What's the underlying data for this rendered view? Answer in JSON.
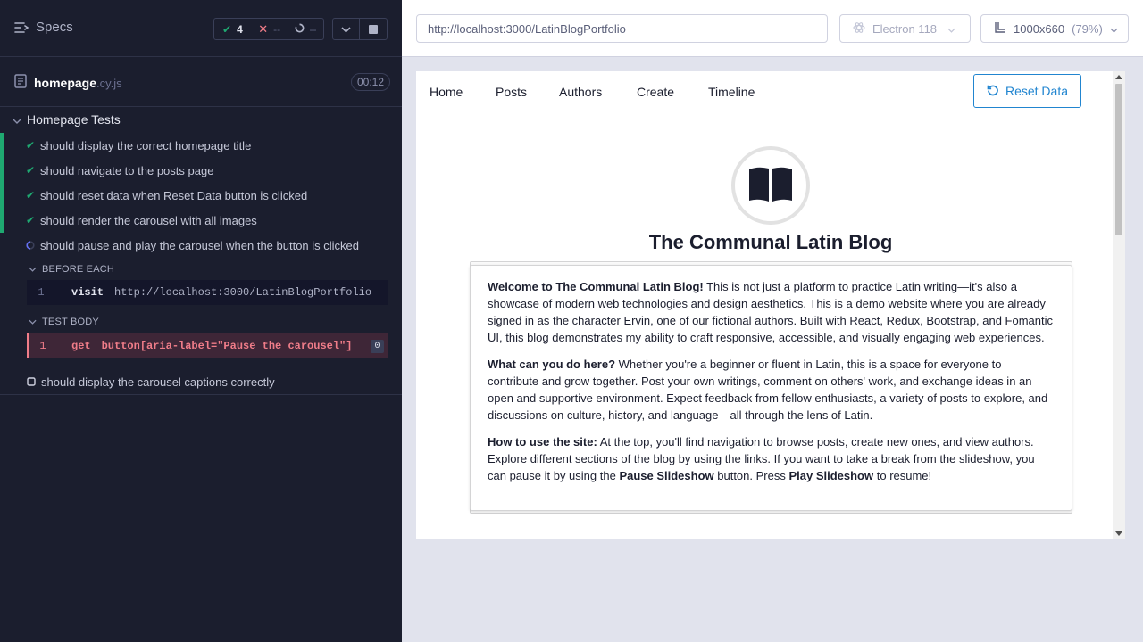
{
  "runner": {
    "specs_label": "Specs",
    "stats": {
      "passed": "4",
      "failed": "--",
      "pending": "--"
    },
    "spec": {
      "name": "homepage",
      "ext": ".cy.js",
      "duration": "00:12"
    },
    "suite_title": "Homepage Tests",
    "tests": [
      {
        "label": "should display the correct homepage title",
        "state": "passed"
      },
      {
        "label": "should navigate to the posts page",
        "state": "passed"
      },
      {
        "label": "should reset data when Reset Data button is clicked",
        "state": "passed"
      },
      {
        "label": "should render the carousel with all images",
        "state": "passed"
      },
      {
        "label": "should pause and play the carousel when the button is clicked",
        "state": "running"
      },
      {
        "label": "should display the carousel captions correctly",
        "state": "pending"
      }
    ],
    "before_each": {
      "label": "BEFORE EACH",
      "command": {
        "line": "1",
        "name": "visit",
        "arg": "http://localhost:3000/LatinBlogPortfolio"
      }
    },
    "test_body": {
      "label": "TEST BODY",
      "command": {
        "line": "1",
        "name": "get",
        "arg": "button[aria-label=\"Pause the carousel\"]",
        "count": "0"
      }
    }
  },
  "preview": {
    "url": "http://localhost:3000/LatinBlogPortfolio",
    "browser": "Electron 118",
    "viewport": "1000x660",
    "zoom": "(79%)"
  },
  "app": {
    "nav": [
      "Home",
      "Posts",
      "Authors",
      "Create",
      "Timeline"
    ],
    "reset_label": "Reset Data",
    "title": "The Communal Latin Blog",
    "p1_bold": "Welcome to The Communal Latin Blog!",
    "p1_text": " This is not just a platform to practice Latin writing—it's also a showcase of modern web technologies and design aesthetics. This is a demo website where you are already signed in as the character Ervin, one of our fictional authors. Built with React, Redux, Bootstrap, and Fomantic UI, this blog demonstrates my ability to craft responsive, accessible, and visually engaging web experiences.",
    "p2_bold": "What can you do here?",
    "p2_text": " Whether you're a beginner or fluent in Latin, this is a space for everyone to contribute and grow together. Post your own writings, comment on others' work, and exchange ideas in an open and supportive environment. Expect feedback from fellow enthusiasts, a variety of posts to explore, and discussions on culture, history, and language—all through the lens of Latin.",
    "p3_bold": "How to use the site:",
    "p3_text_a": " At the top, you'll find navigation to browse posts, create new ones, and view authors. Explore different sections of the blog by using the links. If you want to take a break from the slideshow, you can pause it by using the ",
    "p3_bold_b": "Pause Slideshow",
    "p3_text_b": " button. Press ",
    "p3_bold_c": "Play Slideshow",
    "p3_text_c": " to resume!"
  },
  "colors": {
    "passed": "#1fa971",
    "failed": "#f07d89",
    "accent": "#2185d0",
    "runner_bg": "#1b1e2e"
  }
}
